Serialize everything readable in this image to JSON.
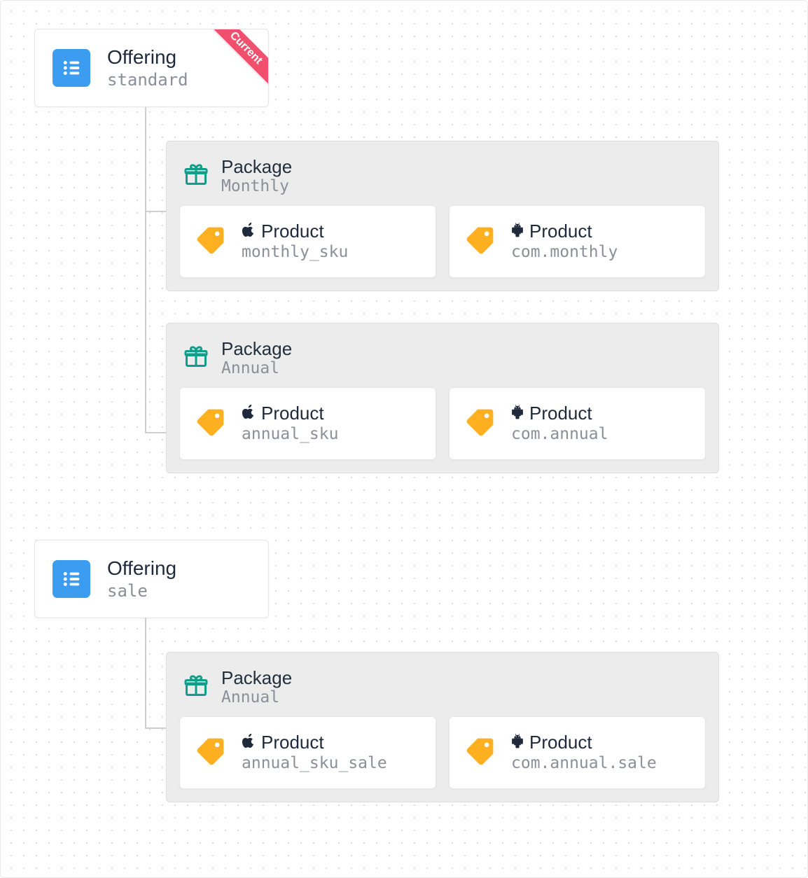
{
  "labels": {
    "offering": "Offering",
    "package": "Package",
    "product": "Product"
  },
  "ribbon": "Current",
  "colors": {
    "accent_blue": "#3c9cf0",
    "ribbon_red": "#f0506e",
    "tag_orange": "#ffb020",
    "gift_teal": "#0f9e8a",
    "text_dark": "#1e2a3b",
    "text_muted": "#8a8f98"
  },
  "offerings": [
    {
      "id": "standard",
      "current": true,
      "packages": [
        {
          "name": "Monthly",
          "products": [
            {
              "platform": "apple",
              "sku": "monthly_sku"
            },
            {
              "platform": "android",
              "sku": "com.monthly"
            }
          ]
        },
        {
          "name": "Annual",
          "products": [
            {
              "platform": "apple",
              "sku": "annual_sku"
            },
            {
              "platform": "android",
              "sku": "com.annual"
            }
          ]
        }
      ]
    },
    {
      "id": "sale",
      "current": false,
      "packages": [
        {
          "name": "Annual",
          "products": [
            {
              "platform": "apple",
              "sku": "annual_sku_sale"
            },
            {
              "platform": "android",
              "sku": "com.annual.sale"
            }
          ]
        }
      ]
    }
  ]
}
